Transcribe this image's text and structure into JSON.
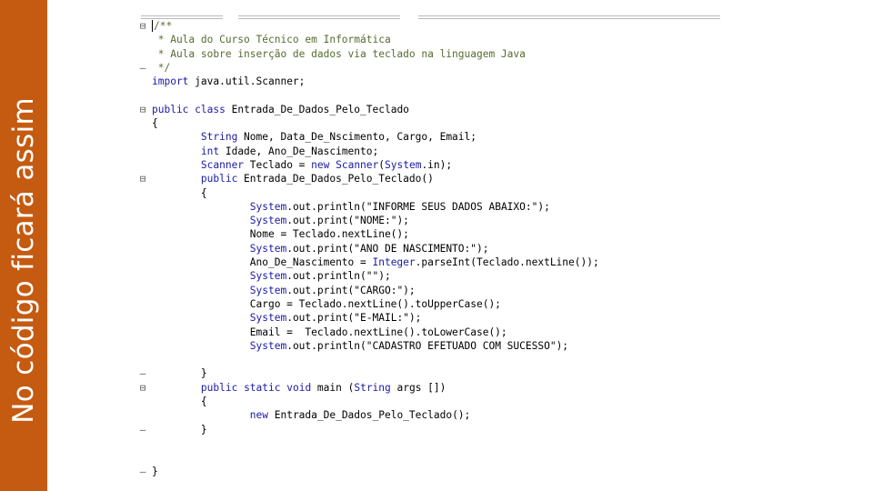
{
  "slide": {
    "sidebar_title": "No código ficará assim",
    "sidebar_color": "#c55a11"
  },
  "editor": {
    "lines": [
      {
        "gutter": "⊟",
        "tokens": [
          {
            "t": "/**",
            "c": "cmt"
          }
        ]
      },
      {
        "gutter": "",
        "tokens": [
          {
            "t": " * Aula do Curso Técnico em Informática",
            "c": "cmt"
          }
        ]
      },
      {
        "gutter": "",
        "tokens": [
          {
            "t": " * Aula sobre inserção de dados via teclado na linguagem Java",
            "c": "cmt"
          }
        ]
      },
      {
        "gutter": "–",
        "tokens": [
          {
            "t": " */",
            "c": "cmt"
          }
        ]
      },
      {
        "gutter": "",
        "tokens": [
          {
            "t": "import",
            "c": "kw"
          },
          {
            "t": " java.util.Scanner;",
            "c": ""
          }
        ]
      },
      {
        "gutter": "",
        "tokens": []
      },
      {
        "gutter": "⊟",
        "tokens": [
          {
            "t": "public",
            "c": "kw"
          },
          {
            "t": " ",
            "c": ""
          },
          {
            "t": "class",
            "c": "kw"
          },
          {
            "t": " Entrada_De_Dados_Pelo_Teclado",
            "c": ""
          }
        ]
      },
      {
        "gutter": "",
        "tokens": [
          {
            "t": "{",
            "c": ""
          }
        ]
      },
      {
        "gutter": "",
        "tokens": [
          {
            "t": "        ",
            "c": ""
          },
          {
            "t": "String",
            "c": "kw"
          },
          {
            "t": " Nome, Data_De_Nscimento, Cargo, Email;",
            "c": ""
          }
        ]
      },
      {
        "gutter": "",
        "tokens": [
          {
            "t": "        ",
            "c": ""
          },
          {
            "t": "int",
            "c": "kw"
          },
          {
            "t": " Idade, Ano_De_Nascimento;",
            "c": ""
          }
        ]
      },
      {
        "gutter": "",
        "tokens": [
          {
            "t": "        ",
            "c": ""
          },
          {
            "t": "Scanner",
            "c": "kw"
          },
          {
            "t": " Teclado = ",
            "c": ""
          },
          {
            "t": "new",
            "c": "kw"
          },
          {
            "t": " ",
            "c": ""
          },
          {
            "t": "Scanner",
            "c": "kw"
          },
          {
            "t": "(",
            "c": ""
          },
          {
            "t": "System",
            "c": "kw"
          },
          {
            "t": ".in);",
            "c": ""
          }
        ]
      },
      {
        "gutter": "⊟",
        "tokens": [
          {
            "t": "        ",
            "c": ""
          },
          {
            "t": "public",
            "c": "kw"
          },
          {
            "t": " Entrada_De_Dados_Pelo_Teclado()",
            "c": ""
          }
        ]
      },
      {
        "gutter": "",
        "tokens": [
          {
            "t": "        {",
            "c": ""
          }
        ]
      },
      {
        "gutter": "",
        "tokens": [
          {
            "t": "                ",
            "c": ""
          },
          {
            "t": "System",
            "c": "kw"
          },
          {
            "t": ".out.println(\"INFORME SEUS DADOS ABAIXO:\");",
            "c": ""
          }
        ]
      },
      {
        "gutter": "",
        "tokens": [
          {
            "t": "                ",
            "c": ""
          },
          {
            "t": "System",
            "c": "kw"
          },
          {
            "t": ".out.print(\"NOME:\");",
            "c": ""
          }
        ]
      },
      {
        "gutter": "",
        "tokens": [
          {
            "t": "                Nome = Teclado.nextLine();",
            "c": ""
          }
        ]
      },
      {
        "gutter": "",
        "tokens": [
          {
            "t": "                ",
            "c": ""
          },
          {
            "t": "System",
            "c": "kw"
          },
          {
            "t": ".out.print(\"ANO DE NASCIMENTO:\");",
            "c": ""
          }
        ]
      },
      {
        "gutter": "",
        "tokens": [
          {
            "t": "                Ano_De_Nascimento = ",
            "c": ""
          },
          {
            "t": "Integer",
            "c": "kw"
          },
          {
            "t": ".parseInt(Teclado.nextLine());",
            "c": ""
          }
        ]
      },
      {
        "gutter": "",
        "tokens": [
          {
            "t": "                ",
            "c": ""
          },
          {
            "t": "System",
            "c": "kw"
          },
          {
            "t": ".out.println(\"\");",
            "c": ""
          }
        ]
      },
      {
        "gutter": "",
        "tokens": [
          {
            "t": "                ",
            "c": ""
          },
          {
            "t": "System",
            "c": "kw"
          },
          {
            "t": ".out.print(\"CARGO:\");",
            "c": ""
          }
        ]
      },
      {
        "gutter": "",
        "tokens": [
          {
            "t": "                Cargo = Teclado.nextLine().toUpperCase();",
            "c": ""
          }
        ]
      },
      {
        "gutter": "",
        "tokens": [
          {
            "t": "                ",
            "c": ""
          },
          {
            "t": "System",
            "c": "kw"
          },
          {
            "t": ".out.print(\"E-MAIL:\");",
            "c": ""
          }
        ]
      },
      {
        "gutter": "",
        "tokens": [
          {
            "t": "                Email =  Teclado.nextLine().toLowerCase();",
            "c": ""
          }
        ]
      },
      {
        "gutter": "",
        "tokens": [
          {
            "t": "                ",
            "c": ""
          },
          {
            "t": "System",
            "c": "kw"
          },
          {
            "t": ".out.println(\"CADASTRO EFETUADO COM SUCESSO\");",
            "c": ""
          }
        ]
      },
      {
        "gutter": "",
        "tokens": []
      },
      {
        "gutter": "–",
        "tokens": [
          {
            "t": "        }",
            "c": ""
          }
        ]
      },
      {
        "gutter": "⊟",
        "tokens": [
          {
            "t": "        ",
            "c": ""
          },
          {
            "t": "public",
            "c": "kw"
          },
          {
            "t": " ",
            "c": ""
          },
          {
            "t": "static",
            "c": "kw"
          },
          {
            "t": " ",
            "c": ""
          },
          {
            "t": "void",
            "c": "kw"
          },
          {
            "t": " main (",
            "c": ""
          },
          {
            "t": "String",
            "c": "kw"
          },
          {
            "t": " args [])",
            "c": ""
          }
        ]
      },
      {
        "gutter": "",
        "tokens": [
          {
            "t": "        {",
            "c": ""
          }
        ]
      },
      {
        "gutter": "",
        "tokens": [
          {
            "t": "                ",
            "c": ""
          },
          {
            "t": "new",
            "c": "kw"
          },
          {
            "t": " Entrada_De_Dados_Pelo_Teclado();",
            "c": ""
          }
        ]
      },
      {
        "gutter": "–",
        "tokens": [
          {
            "t": "        }",
            "c": ""
          }
        ]
      },
      {
        "gutter": "",
        "tokens": []
      },
      {
        "gutter": "",
        "tokens": []
      },
      {
        "gutter": "–",
        "tokens": [
          {
            "t": "}",
            "c": ""
          }
        ]
      }
    ]
  }
}
